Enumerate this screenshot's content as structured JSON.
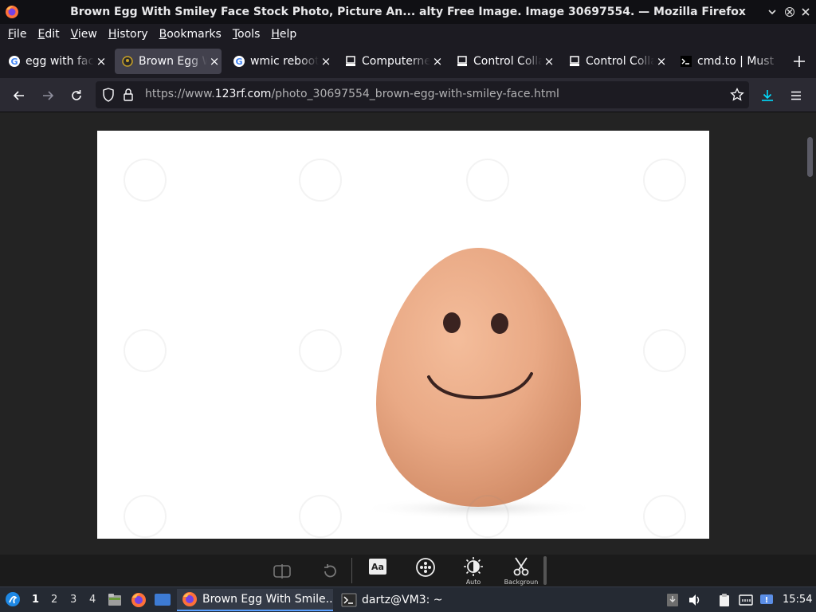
{
  "window": {
    "title": "Brown Egg With Smiley Face Stock Photo, Picture An... alty Free Image. Image 30697554. — Mozilla Firefox",
    "icons": [
      "firefox-icon",
      "minimize-icon",
      "maximize-icon",
      "close-icon"
    ]
  },
  "menubar": {
    "file": "File",
    "edit": "Edit",
    "view": "View",
    "history": "History",
    "bookmarks": "Bookmarks",
    "tools": "Tools",
    "help": "Help"
  },
  "tabs": [
    {
      "label": "egg with face",
      "icon": "google-icon",
      "active": false
    },
    {
      "label": "Brown Egg With Smiley Face",
      "icon": "123rf-icon",
      "active": true
    },
    {
      "label": "wmic reboot",
      "icon": "google-icon",
      "active": false
    },
    {
      "label": "Computernetworking",
      "icon": "computer-icon",
      "active": false
    },
    {
      "label": "Control Collapse",
      "icon": "computer-icon",
      "active": false
    },
    {
      "label": "Control Collapse",
      "icon": "computer-icon",
      "active": false
    },
    {
      "label": "cmd.to | Must",
      "icon": "terminal-icon",
      "active": false
    }
  ],
  "navbar": {
    "url_prefix": "https://www.",
    "url_host": "123rf.com",
    "url_path": "/photo_30697554_brown-egg-with-smiley-face.html"
  },
  "image_toolbar": {
    "auto_label": "Auto",
    "background_label": "Backgroun"
  },
  "taskbar": {
    "workspaces": [
      "1",
      "2",
      "3",
      "4"
    ],
    "current_workspace": "1",
    "tasks": [
      {
        "label": "Brown Egg With Smile...",
        "icon": "firefox-icon",
        "active": true
      },
      {
        "label": "dartz@VM3: ~",
        "icon": "terminal-icon",
        "active": false
      }
    ],
    "clock": "15:54"
  },
  "colors": {
    "accent": "#5aa0ff",
    "download_arrow": "#00ddff",
    "egg": "#e9a985"
  }
}
